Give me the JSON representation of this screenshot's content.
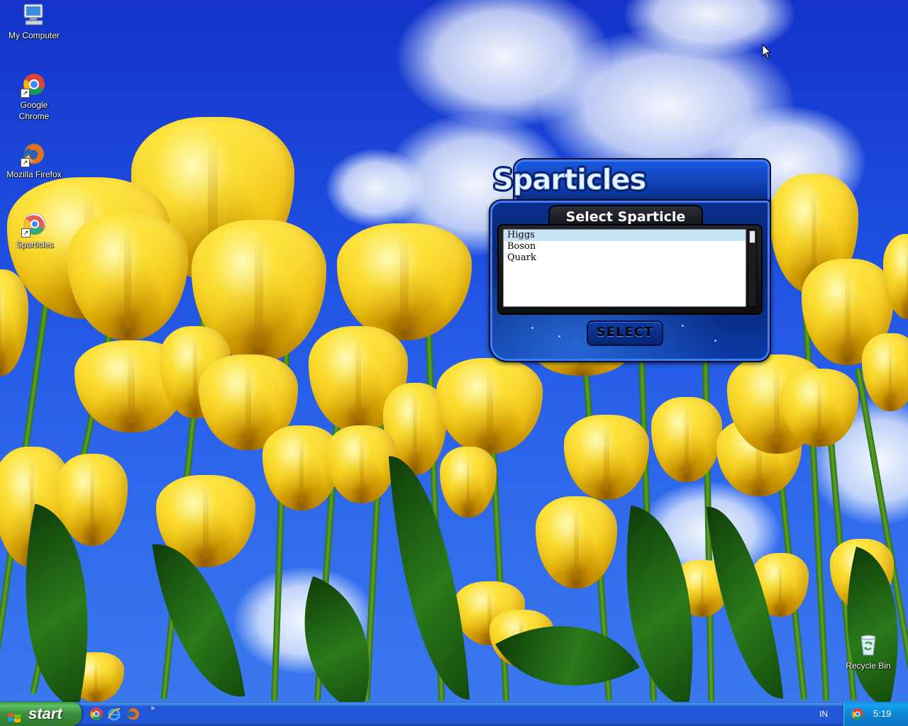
{
  "desktop": {
    "icons": [
      {
        "label": "My Computer",
        "icon": "my-computer-icon"
      },
      {
        "label_line1": "Google",
        "label_line2": "Chrome",
        "icon": "chrome-icon"
      },
      {
        "label": "Mozilla Firefox",
        "icon": "firefox-icon"
      },
      {
        "label": "Sparticles",
        "icon": "sparticles-icon"
      },
      {
        "label": "Recycle Bin",
        "icon": "recycle-bin-icon"
      }
    ]
  },
  "sparticles": {
    "logo": "Sparticles",
    "heading": "Select Sparticle",
    "items": [
      "Higgs",
      "Boson",
      "Quark"
    ],
    "selected_index": 0,
    "select_button": "SELECT"
  },
  "taskbar": {
    "start_label": "start",
    "quick_launch": [
      "chrome-icon",
      "ie-icon",
      "firefox-icon"
    ],
    "more": "»",
    "language": "IN",
    "clock": "5:19"
  },
  "colors": {
    "sky": "#1e4fe0",
    "tulip": "#f2c81a",
    "window_blue": "#0b2f8c",
    "taskbar_blue": "#2157d7",
    "start_green": "#3a8d3a",
    "list_selection": "#c6e2f5"
  }
}
